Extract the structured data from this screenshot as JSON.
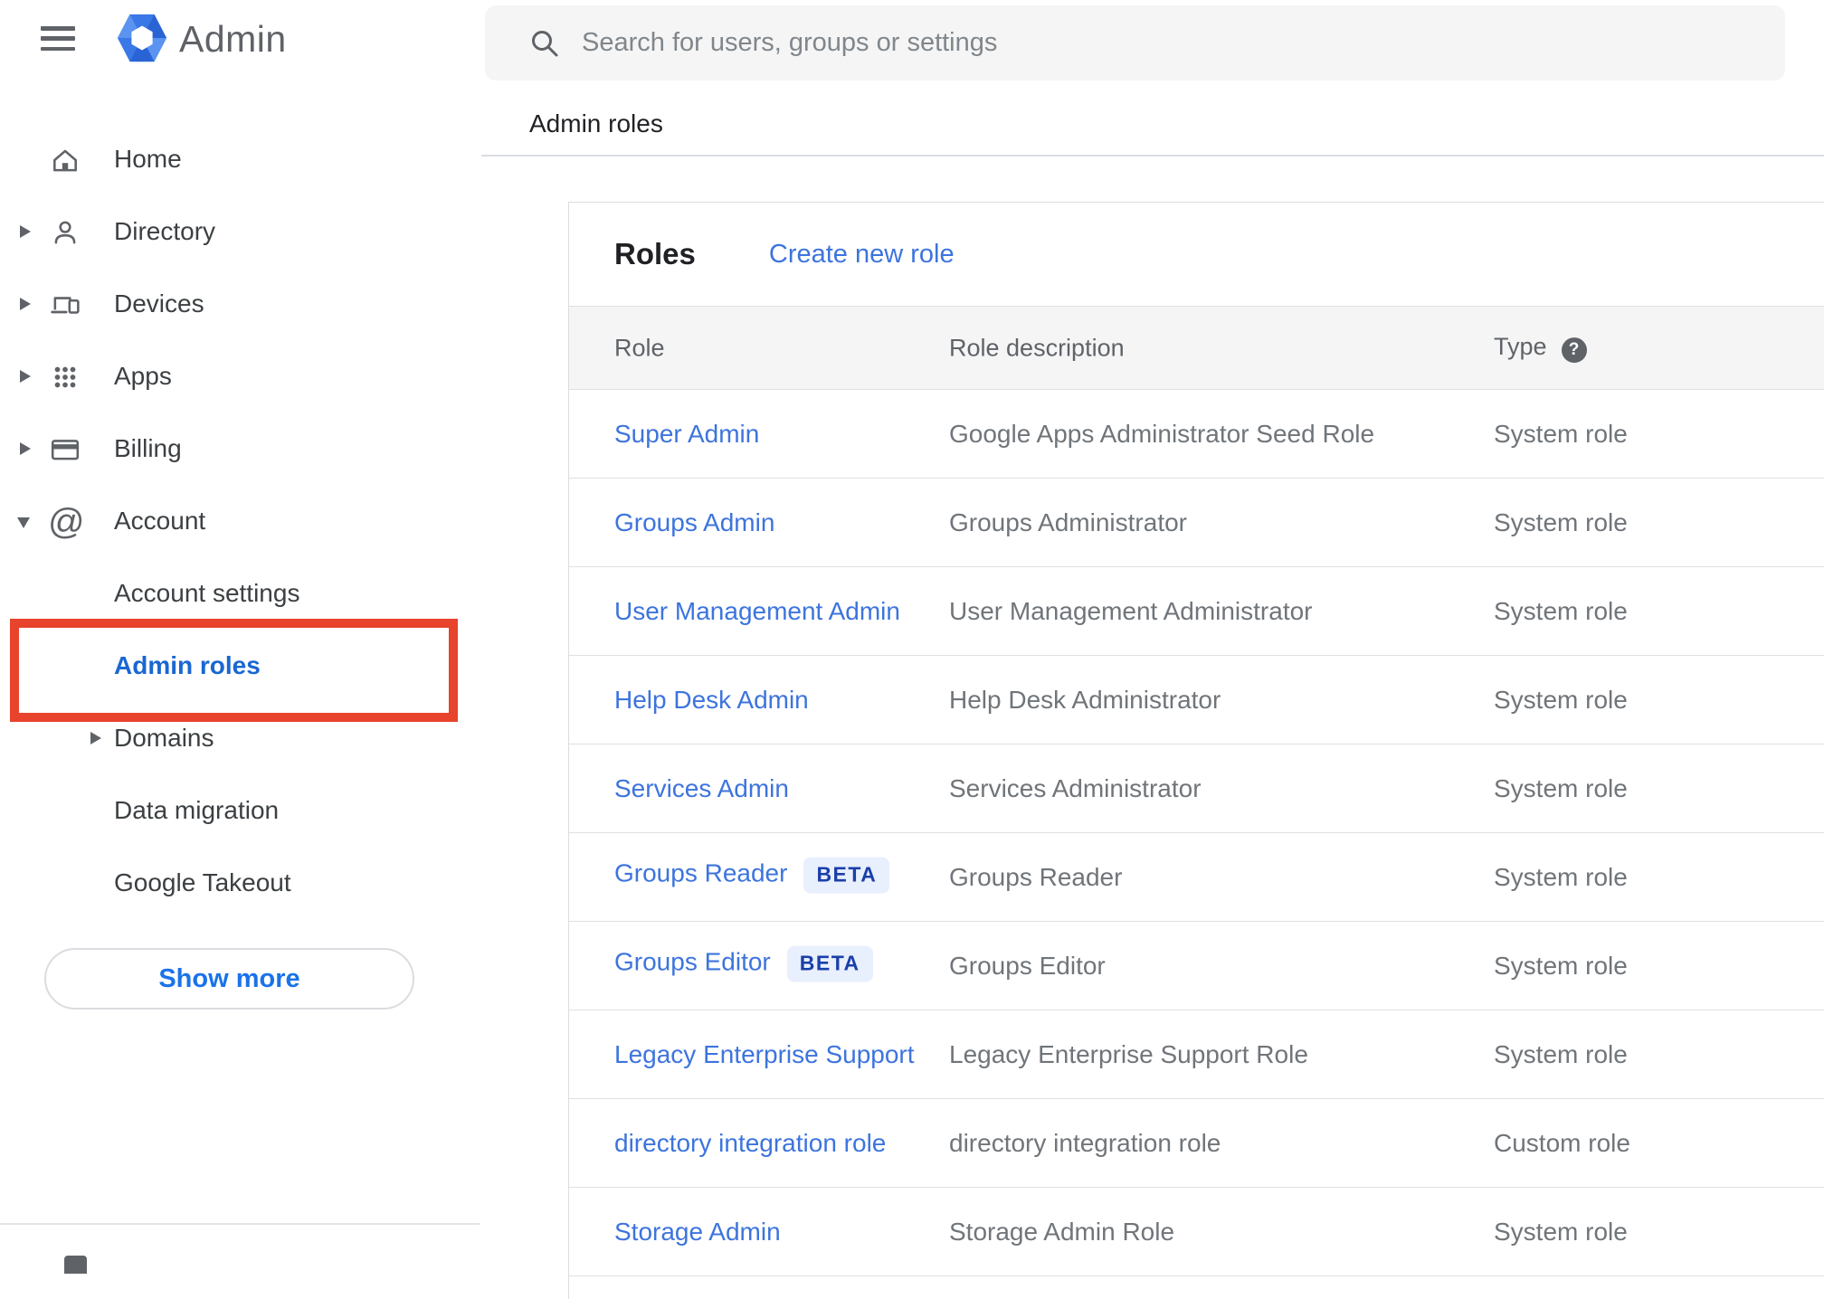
{
  "app": {
    "product_name": "Admin"
  },
  "search": {
    "placeholder": "Search for users, groups or settings"
  },
  "breadcrumb": "Admin roles",
  "sidebar": {
    "items": [
      {
        "id": "home",
        "label": "Home",
        "icon": "home",
        "arrow": "none"
      },
      {
        "id": "directory",
        "label": "Directory",
        "icon": "person",
        "arrow": "right"
      },
      {
        "id": "devices",
        "label": "Devices",
        "icon": "devices",
        "arrow": "right"
      },
      {
        "id": "apps",
        "label": "Apps",
        "icon": "apps",
        "arrow": "right"
      },
      {
        "id": "billing",
        "label": "Billing",
        "icon": "card",
        "arrow": "right"
      },
      {
        "id": "account",
        "label": "Account",
        "icon": "at",
        "arrow": "down"
      },
      {
        "id": "account-settings",
        "label": "Account settings",
        "icon": "none",
        "arrow": "none",
        "child": true
      },
      {
        "id": "admin-roles",
        "label": "Admin roles",
        "icon": "none",
        "arrow": "none",
        "child": true,
        "selected": true,
        "annotated": true
      },
      {
        "id": "domains",
        "label": "Domains",
        "icon": "none",
        "arrow": "right",
        "child": true
      },
      {
        "id": "data-migration",
        "label": "Data migration",
        "icon": "none",
        "arrow": "none",
        "child": true
      },
      {
        "id": "google-takeout",
        "label": "Google Takeout",
        "icon": "none",
        "arrow": "none",
        "child": true
      }
    ],
    "show_more_label": "Show more"
  },
  "main": {
    "title": "Roles",
    "create_link": "Create new role",
    "table": {
      "columns": [
        "Role",
        "Role description",
        "Type"
      ],
      "beta_label": "BETA",
      "rows": [
        {
          "role": "Super Admin",
          "beta": false,
          "description": "Google Apps Administrator Seed Role",
          "type": "System role"
        },
        {
          "role": "Groups Admin",
          "beta": false,
          "description": "Groups Administrator",
          "type": "System role"
        },
        {
          "role": "User Management Admin",
          "beta": false,
          "description": "User Management Administrator",
          "type": "System role"
        },
        {
          "role": "Help Desk Admin",
          "beta": false,
          "description": "Help Desk Administrator",
          "type": "System role"
        },
        {
          "role": "Services Admin",
          "beta": false,
          "description": "Services Administrator",
          "type": "System role"
        },
        {
          "role": "Groups Reader",
          "beta": true,
          "description": "Groups Reader",
          "type": "System role"
        },
        {
          "role": "Groups Editor",
          "beta": true,
          "description": "Groups Editor",
          "type": "System role"
        },
        {
          "role": "Legacy Enterprise Support",
          "beta": false,
          "description": "Legacy Enterprise Support Role",
          "type": "System role"
        },
        {
          "role": "directory integration role",
          "beta": false,
          "description": "directory integration role",
          "type": "Custom role"
        },
        {
          "role": "Storage Admin",
          "beta": false,
          "description": "Storage Admin Role",
          "type": "System role"
        }
      ]
    }
  },
  "colors": {
    "link_blue": "#3d74dd",
    "selected_nav_blue": "#1967d2",
    "selected_nav_bg": "#e8f0fe",
    "annotation_red": "#e8432c",
    "beta_badge_bg": "#e8effd",
    "beta_badge_text": "#1a3fa8",
    "table_header_bg": "#f5f5f5",
    "divider": "#e0e0e0",
    "logo_blue": "#3b78e7"
  }
}
